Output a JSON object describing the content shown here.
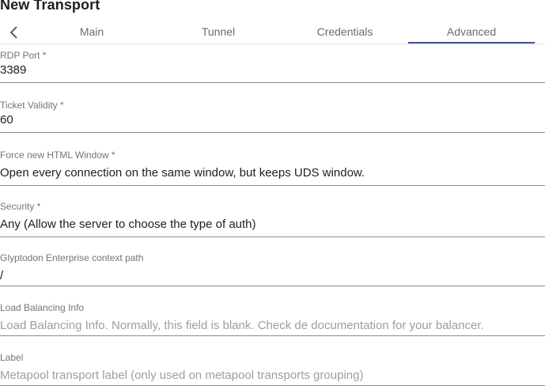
{
  "dialog": {
    "title": "New Transport"
  },
  "tabs": [
    {
      "label": "Main"
    },
    {
      "label": "Tunnel"
    },
    {
      "label": "Credentials"
    },
    {
      "label": "Advanced"
    }
  ],
  "active_tab": "Advanced",
  "accent_color": "#3f51b5",
  "fields": {
    "rdp_port": {
      "label": "RDP Port *",
      "value": "3389"
    },
    "ticket_validity": {
      "label": "Ticket Validity *",
      "value": "60"
    },
    "force_new_window": {
      "label": "Force new HTML Window *",
      "value": "Open every connection on the same window, but keeps UDS window."
    },
    "security": {
      "label": "Security *",
      "value": "Any (Allow the server to choose the type of auth)"
    },
    "glyptodon_path": {
      "label": "Glyptodon Enterprise context path",
      "value": "/"
    },
    "load_balancing": {
      "label": "Load Balancing Info",
      "value": "",
      "placeholder": "Load Balancing Info. Normally, this field is blank. Check de documentation for your balancer."
    },
    "label": {
      "label": "Label",
      "value": "",
      "placeholder": "Metapool transport label (only used on metapool transports grouping)"
    }
  }
}
